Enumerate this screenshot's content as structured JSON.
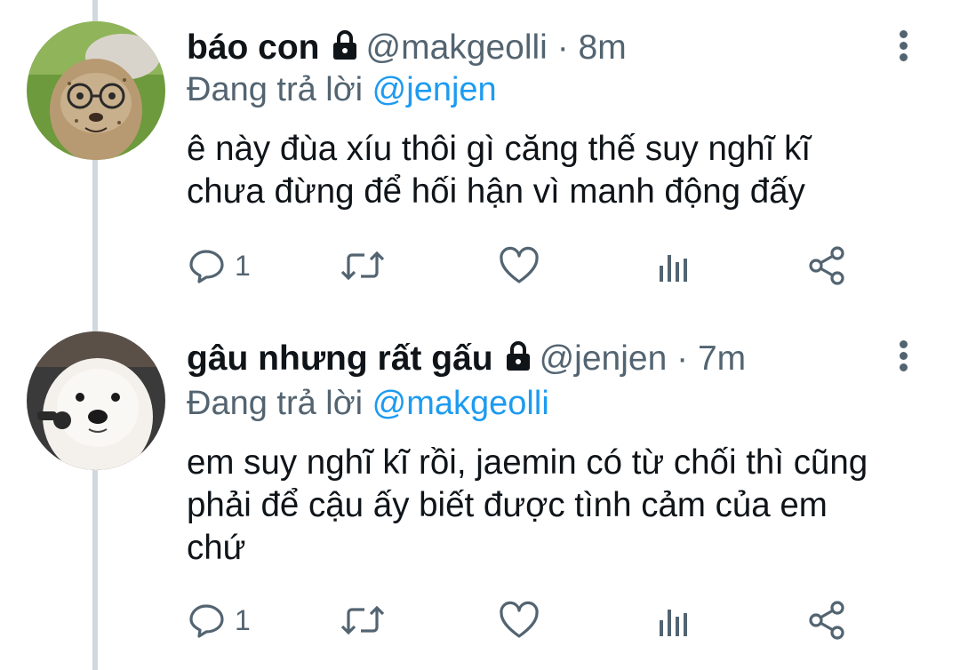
{
  "tweets": [
    {
      "name": "báo con",
      "handle": "@makgeolli",
      "separator": "·",
      "time": "8m",
      "replying_prefix": "Đang trả lời ",
      "replying_to": "@jenjen",
      "text_lines": [
        "ê này đùa xíu thôi gì căng thế suy nghĩ kĩ",
        "chưa đừng để hối hận vì manh động đấy"
      ],
      "reply_count": "1",
      "avatar_icon": "cheetah-cub-avatar"
    },
    {
      "name": "gâu nhưng rất gấu",
      "handle": "@jenjen",
      "separator": "·",
      "time": "7m",
      "replying_prefix": "Đang trả lời ",
      "replying_to": "@makgeolli",
      "text_lines": [
        "em suy nghĩ kĩ rồi, jaemin có từ chối thì cũng",
        "phải để cậu ấy biết được tình cảm của em",
        "chứ"
      ],
      "reply_count": "1",
      "avatar_icon": "white-dog-avatar"
    }
  ],
  "colors": {
    "link": "#1d9bf0",
    "secondary": "#536471",
    "text": "#0f1419",
    "thread_line": "#cfd9de"
  },
  "icons": [
    "lock-icon",
    "more-icon",
    "reply-icon",
    "retweet-icon",
    "like-icon",
    "analytics-icon",
    "share-icon"
  ]
}
